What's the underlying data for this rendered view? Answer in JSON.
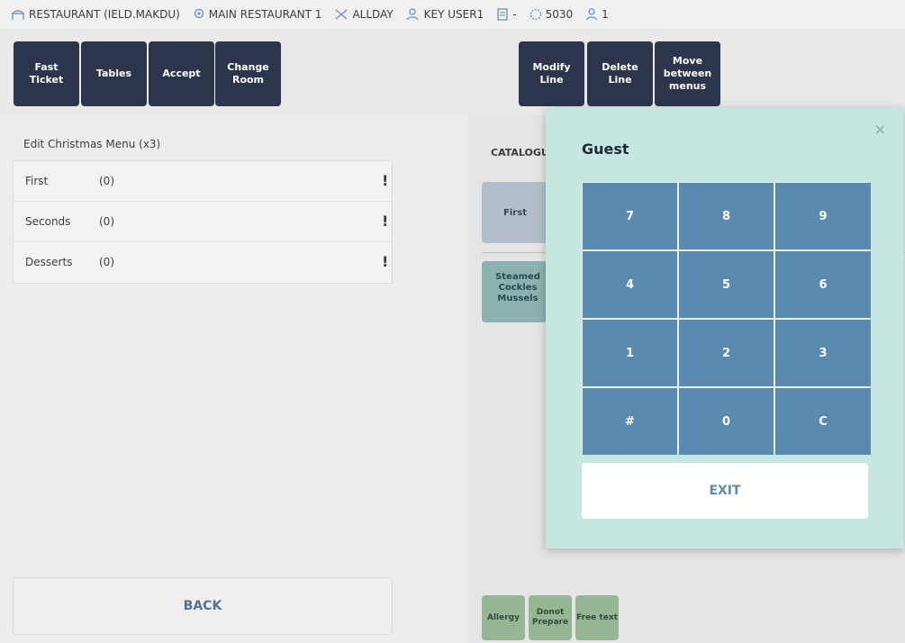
{
  "statusbar": {
    "restaurant": "RESTAURANT (IELD.MAKDU)",
    "location": "MAIN RESTAURANT 1",
    "service": "ALLDAY",
    "user": "KEY USER1",
    "ticket": "-",
    "terminal": "5030",
    "guests": "1"
  },
  "toolbar": {
    "fast_ticket": "Fast Ticket",
    "tables": "Tables",
    "accept": "Accept",
    "change_room": "Change Room",
    "modify_line": "Modify Line",
    "delete_line": "Delete Line",
    "move_between_menus": "Move between menus"
  },
  "menu": {
    "title": "Edit Christmas Menu (x3)",
    "rows": [
      {
        "name": "First",
        "count": "(0)",
        "warn": "!"
      },
      {
        "name": "Seconds",
        "count": "(0)",
        "warn": "!"
      },
      {
        "name": "Desserts",
        "count": "(0)",
        "warn": "!"
      }
    ],
    "back_label": "BACK"
  },
  "catalogue": {
    "title": "CATALOGUE",
    "tab_first": "First",
    "product": "Steamed Cockles Mussels",
    "tags": [
      "Allergy",
      "Donot Prepare",
      "Free text"
    ]
  },
  "modal": {
    "close": "×",
    "title": "Guest",
    "keys": [
      "7",
      "8",
      "9",
      "4",
      "5",
      "6",
      "1",
      "2",
      "3",
      "#",
      "0",
      "C"
    ],
    "exit_label": "EXIT"
  },
  "colors": {
    "toolbar_button": "#0f1a33",
    "modal_bg": "#c6e6e2",
    "keypad_key": "#5a8aaf",
    "accent_text": "#5b8bb3"
  }
}
